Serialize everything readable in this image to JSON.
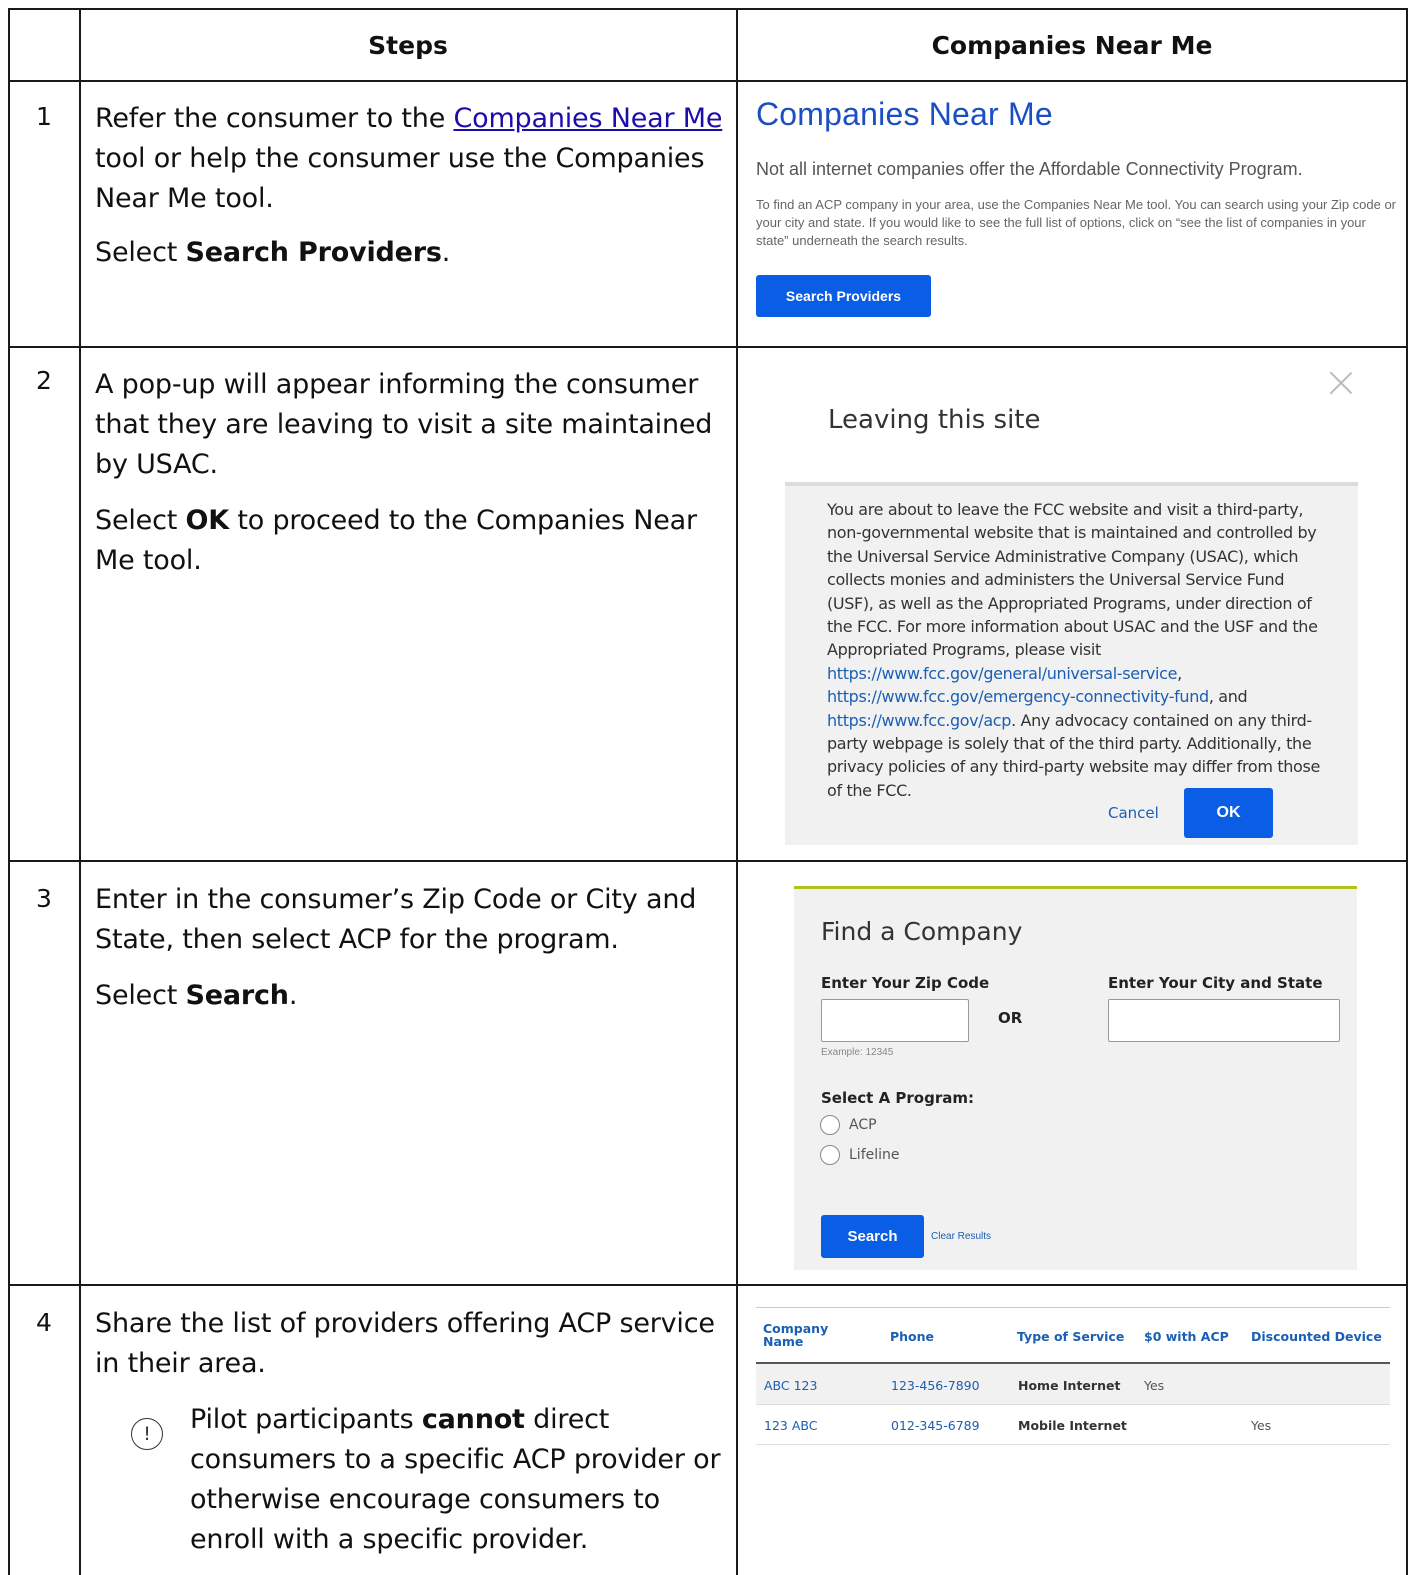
{
  "table": {
    "headers": {
      "steps": "Steps",
      "companies": "Companies Near Me"
    },
    "rows": [
      {
        "num": "1",
        "p1_pre": "Refer the consumer to the ",
        "p1_link": "Companies Near Me",
        "p1_post": " tool or help the consumer use the Companies Near Me tool.",
        "p2_pre": "Select ",
        "p2_bold": "Search Providers",
        "p2_post": "."
      },
      {
        "num": "2",
        "p1": "A pop-up will appear informing the consumer that they are leaving to visit a site maintained by USAC.",
        "p2_pre": "Select ",
        "p2_bold": "OK",
        "p2_post": " to proceed to the Companies Near Me tool."
      },
      {
        "num": "3",
        "p1": "Enter in the consumer’s Zip Code or City and State, then select ACP for the program.",
        "p2_pre": "Select ",
        "p2_bold": "Search",
        "p2_post": "."
      },
      {
        "num": "4",
        "p1": "Share the list of providers offering ACP service in their area.",
        "notice_pre": "Pilot participants ",
        "notice_bold": "cannot",
        "notice_post": " direct consumers to a specific ACP provider or otherwise encourage consumers to enroll with a specific provider."
      }
    ]
  },
  "cnm": {
    "title": "Companies Near Me",
    "subtitle": "Not all internet companies offer the Affordable Connectivity Program.",
    "description": "To find an ACP company in your area, use the Companies Near Me tool. You can search using your Zip code or your city and state. If you would like to see the full list of options, click on “see the list of companies in your state” underneath the search results.",
    "button": "Search Providers"
  },
  "modal": {
    "title": "Leaving this site",
    "text_1": "You are about to leave the FCC website and visit a third-party, non-governmental website that is maintained and controlled by the Universal Service Administrative Company (USAC), which collects monies and administers the Universal Service Fund (USF), as well as the Appropriated Programs, under direction of the FCC. For more information about USAC and the USF and the Appropriated Programs, please visit ",
    "link_1": "https://www.fcc.gov/general/universal-service",
    "sep_1": ", ",
    "link_2": "https://www.fcc.gov/emergency-connectivity-fund",
    "sep_2": ", and ",
    "link_3": "https://www.fcc.gov/acp",
    "text_2": ". Any advocacy contained on any third-party webpage is solely that of the third party. Additionally, the privacy policies of any third-party website may differ from those of the FCC.",
    "cancel": "Cancel",
    "ok": "OK"
  },
  "find": {
    "title": "Find a Company",
    "zip_label": "Enter Your Zip Code",
    "or": "OR",
    "city_label": "Enter Your City and State",
    "zip_hint": "Example: 12345",
    "program_label": "Select A Program:",
    "options": [
      "ACP",
      "Lifeline"
    ],
    "search": "Search",
    "clear": "Clear Results"
  },
  "providers": {
    "headers": [
      "Company Name",
      "Phone",
      "Type of Service",
      "$0 with ACP",
      "Discounted Device"
    ],
    "rows": [
      {
        "name": "ABC 123",
        "phone": "123-456-7890",
        "type": "Home Internet",
        "zero": "Yes",
        "device": ""
      },
      {
        "name": "123 ABC",
        "phone": "012-345-6789",
        "type": "Mobile Internet",
        "zero": "",
        "device": "Yes"
      }
    ]
  },
  "colors": {
    "accent_blue": "#0a5ee5",
    "link_blue": "#1a5fb4",
    "find_border": "#b3c11c",
    "panel_gray": "#f1f1f1"
  }
}
